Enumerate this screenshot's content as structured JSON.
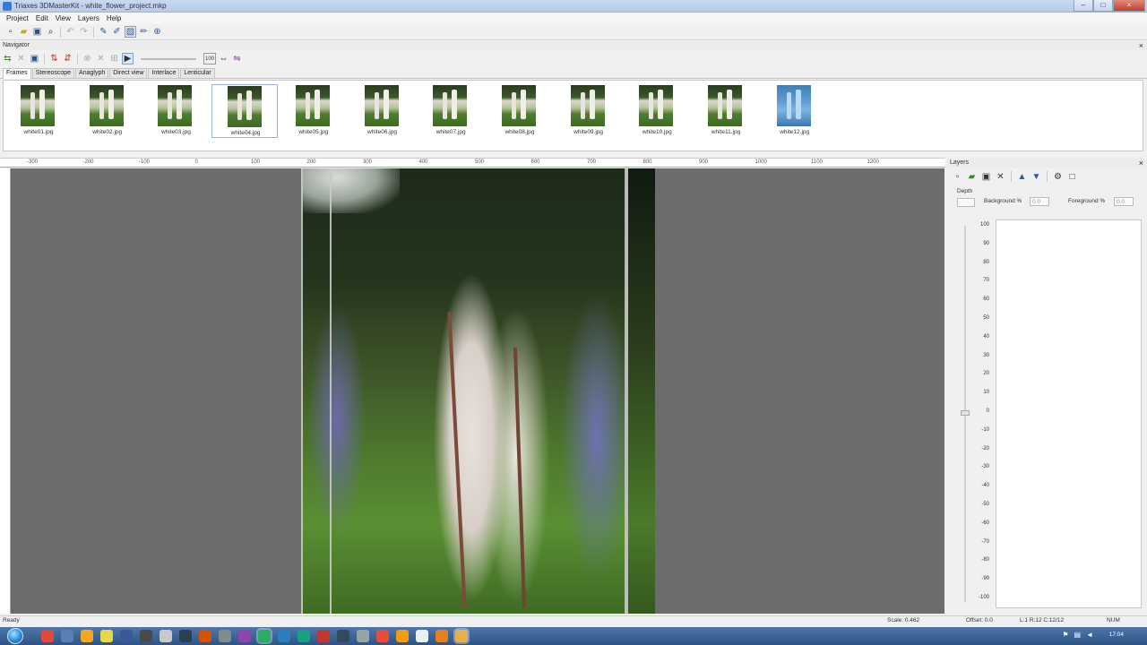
{
  "window": {
    "title": "Triaxes 3DMasterKit - white_flower_project.mkp",
    "controls": [
      "–",
      "□",
      "×"
    ]
  },
  "menu": [
    "Project",
    "Edit",
    "View",
    "Layers",
    "Help"
  ],
  "navigator": {
    "title": "Navigator",
    "tabs": [
      "Frames",
      "Stereoscope",
      "Anaglyph",
      "Direct view",
      "Interlace",
      "Lenticular"
    ],
    "active_tab": 0,
    "frames": [
      {
        "name": "white01.jpg"
      },
      {
        "name": "white02.jpg"
      },
      {
        "name": "white03.jpg"
      },
      {
        "name": "white04.jpg",
        "selected": true
      },
      {
        "name": "white05.jpg"
      },
      {
        "name": "white06.jpg"
      },
      {
        "name": "white07.jpg"
      },
      {
        "name": "white08.jpg"
      },
      {
        "name": "white09.jpg"
      },
      {
        "name": "white10.jpg"
      },
      {
        "name": "white11.jpg"
      },
      {
        "name": "white12.jpg",
        "highlight": true
      }
    ],
    "zoom_value": "100"
  },
  "layers": {
    "title": "Layers",
    "depth_label": "Depth",
    "background_label": "Background %",
    "background_value": "0.0",
    "foreground_label": "Foreground %",
    "foreground_value": "0.0",
    "depth_scale": [
      "100",
      "90",
      "80",
      "70",
      "60",
      "50",
      "40",
      "30",
      "20",
      "10",
      "0",
      "-10",
      "-20",
      "-30",
      "-40",
      "-50",
      "-60",
      "-70",
      "-80",
      "-90",
      "-100"
    ],
    "depth_value": 0
  },
  "ruler_labels": [
    "-300",
    "-200",
    "-100",
    "0",
    "100",
    "200",
    "300",
    "400",
    "500",
    "600",
    "700",
    "800",
    "900",
    "1000",
    "1100",
    "1200"
  ],
  "status": {
    "left": "Ready",
    "scale": "Scale: 0.462",
    "offset": "Offset: 0.0",
    "position": "L:1  R:12  C:12/12",
    "num": "NUM"
  },
  "taskbar": {
    "clock": "17:04",
    "icon_colors": [
      "#e04a3a",
      "#5a7fb0",
      "#f5a623",
      "#e8d44d",
      "#3b5998",
      "#4a4a4a",
      "#c8c8c8",
      "#2c3e50",
      "#d35400",
      "#7f8c8d",
      "#8e44ad",
      "#27ae60",
      "#2980b9",
      "#16a085",
      "#c0392b",
      "#34495e",
      "#95a5a6",
      "#e74c3c",
      "#f39c12",
      "#ecf0f1",
      "#e67e22",
      "#e8b04a"
    ]
  }
}
